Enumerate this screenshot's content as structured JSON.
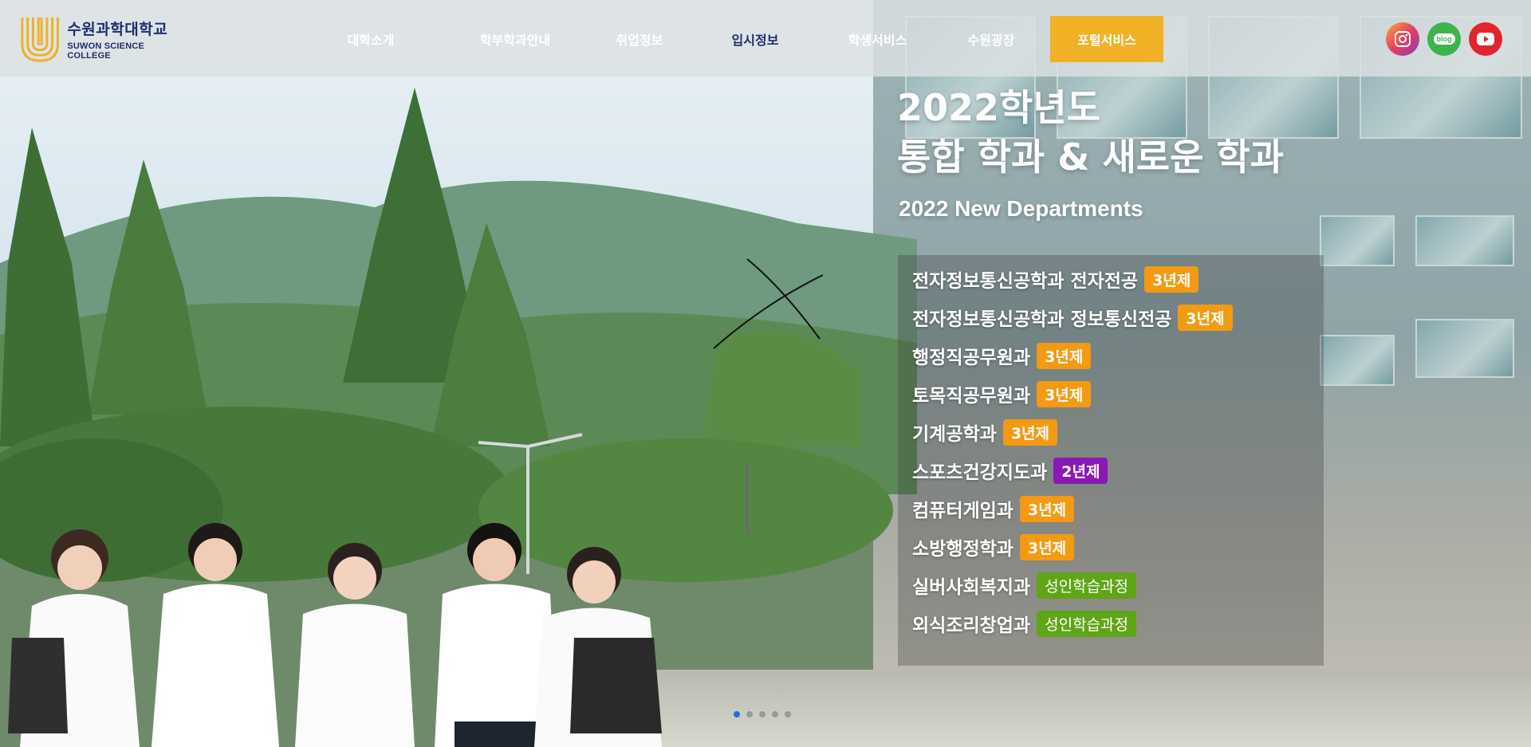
{
  "header": {
    "logo": {
      "name_ko": "수원과학대학교",
      "name_en": "SUWON SCIENCE COLLEGE"
    },
    "nav": [
      {
        "label": "대학소개",
        "name": "nav-about"
      },
      {
        "label": "학부학과안내",
        "name": "nav-departments"
      },
      {
        "label": "취업정보",
        "name": "nav-employment"
      },
      {
        "label": "입시정보",
        "name": "nav-admissions"
      },
      {
        "label": "학생서비스",
        "name": "nav-student-services"
      },
      {
        "label": "수원광장",
        "name": "nav-suwon-plaza"
      },
      {
        "label": "포털서비스",
        "name": "nav-portal"
      }
    ],
    "active_nav": "입시정보",
    "social": [
      {
        "icon": "instagram-icon",
        "color": "#e4405f"
      },
      {
        "icon": "blog-icon",
        "label": "blog",
        "color": "#3bb54a"
      },
      {
        "icon": "youtube-icon",
        "color": "#e0262c"
      }
    ]
  },
  "hero": {
    "title_line1": "2022학년도",
    "title_line2": "통합 학과 & 새로운 학과",
    "subtitle": "2022 New Departments",
    "departments": [
      {
        "name": "전자정보통신공학과 전자전공",
        "badge": "3년제",
        "badge_color": "#f39a12"
      },
      {
        "name": "전자정보통신공학과 정보통신전공",
        "badge": "3년제",
        "badge_color": "#f39a12"
      },
      {
        "name": "행정직공무원과",
        "badge": "3년제",
        "badge_color": "#f39a12"
      },
      {
        "name": "토목직공무원과",
        "badge": "3년제",
        "badge_color": "#f39a12"
      },
      {
        "name": "기계공학과",
        "badge": "3년제",
        "badge_color": "#f39a12"
      },
      {
        "name": "스포츠건강지도과",
        "badge": "2년제",
        "badge_color": "#8a19b3"
      },
      {
        "name": "컴퓨터게임과",
        "badge": "3년제",
        "badge_color": "#f39a12"
      },
      {
        "name": "소방행정학과",
        "badge": "3년제",
        "badge_color": "#f39a12"
      },
      {
        "name": "실버사회복지과",
        "badge": "성인학습과정",
        "badge_color": "#5fa517"
      },
      {
        "name": "외식조리창업과",
        "badge": "성인학습과정",
        "badge_color": "#5fa517"
      }
    ]
  },
  "carousel": {
    "slides": 5,
    "active": 1
  },
  "colors": {
    "accent": "#f0b126",
    "brand": "#1d2f6d"
  }
}
